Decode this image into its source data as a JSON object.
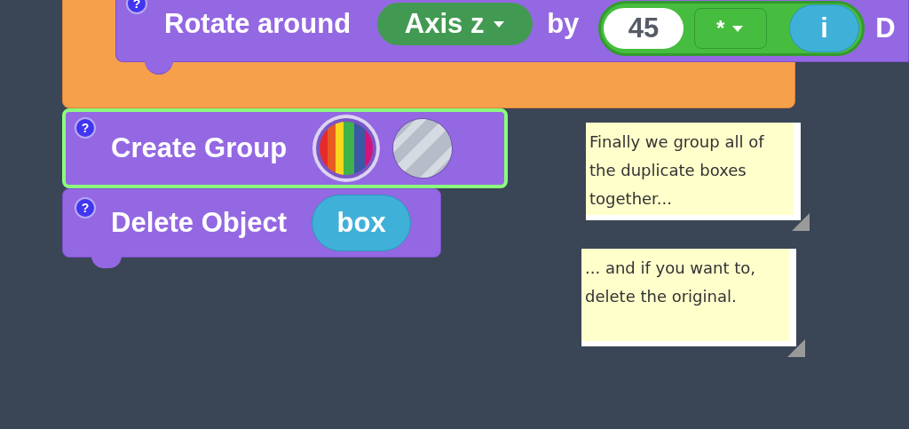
{
  "top_block": {
    "help": "?",
    "label": "Rotate around",
    "dropdown": "Axis z",
    "connector": "by",
    "reporter": {
      "value": "45",
      "operator": "*",
      "variable": "i"
    },
    "trailing_text": "D"
  },
  "blocks": [
    {
      "help": "?",
      "label": "Create Group",
      "selected": true,
      "inputs": [
        {
          "kind": "rainbow"
        },
        {
          "kind": "striped"
        }
      ]
    },
    {
      "help": "?",
      "label": "Delete Object",
      "selected": false,
      "inputs": [
        {
          "kind": "variable",
          "text": "box"
        }
      ]
    }
  ],
  "notes": [
    {
      "text": "Finally we group all of the duplicate boxes together..."
    },
    {
      "text": "... and if you want to, delete the original."
    }
  ]
}
